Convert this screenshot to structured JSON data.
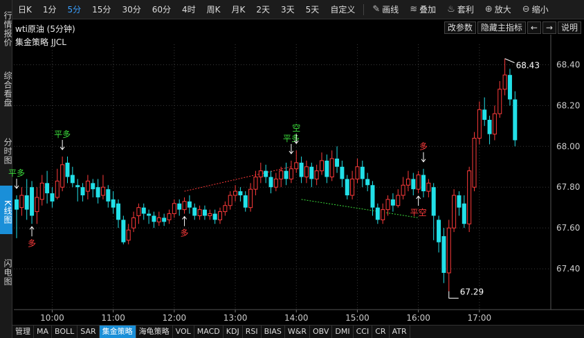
{
  "rail": {
    "tabs": [
      {
        "label": "行情报价",
        "active": false
      },
      {
        "label": "综合看盘",
        "active": false
      },
      {
        "label": "分时图",
        "active": false
      },
      {
        "label": "K线图",
        "active": true
      },
      {
        "label": "闪电图",
        "active": false
      }
    ]
  },
  "toolbar": {
    "periods": [
      {
        "label": "日K",
        "active": false
      },
      {
        "label": "1分",
        "active": false
      },
      {
        "label": "5分",
        "active": true
      },
      {
        "label": "15分",
        "active": false
      },
      {
        "label": "30分",
        "active": false
      },
      {
        "label": "60分",
        "active": false
      },
      {
        "label": "4时",
        "active": false
      },
      {
        "label": "周K",
        "active": false
      },
      {
        "label": "月K",
        "active": false
      },
      {
        "label": "2天",
        "active": false
      },
      {
        "label": "3天",
        "active": false
      },
      {
        "label": "5天",
        "active": false
      },
      {
        "label": "自定义",
        "active": false
      }
    ],
    "tools": [
      {
        "label": "画线",
        "icon": "pencil-icon",
        "glyph": "✎"
      },
      {
        "label": "叠加",
        "icon": "layers-icon",
        "glyph": "≋"
      },
      {
        "label": "套利",
        "icon": "money-bag-icon",
        "glyph": "♨"
      },
      {
        "label": "放大",
        "icon": "zoom-in-icon",
        "glyph": "⊕"
      },
      {
        "label": "缩小",
        "icon": "zoom-out-icon",
        "glyph": "⊖"
      }
    ]
  },
  "header": {
    "title": "wti原油 (5分钟)",
    "change_params": "改参数",
    "hide_indicator": "隐藏主指标",
    "prev_arrow": "←",
    "next_arrow": "→",
    "help": "说明",
    "strategy": "集金策略 JJCL"
  },
  "bottom_tabs": [
    {
      "label": "管理",
      "active": false
    },
    {
      "label": "MA",
      "active": false
    },
    {
      "label": "BOLL",
      "active": false
    },
    {
      "label": "SAR",
      "active": false
    },
    {
      "label": "集金策略",
      "active": true
    },
    {
      "label": "海龟策略",
      "active": false
    },
    {
      "label": "VOL",
      "active": false
    },
    {
      "label": "MACD",
      "active": false
    },
    {
      "label": "KDJ",
      "active": false
    },
    {
      "label": "RSI",
      "active": false
    },
    {
      "label": "BIAS",
      "active": false
    },
    {
      "label": "W&R",
      "active": false
    },
    {
      "label": "OBV",
      "active": false
    },
    {
      "label": "DMI",
      "active": false
    },
    {
      "label": "CCI",
      "active": false
    },
    {
      "label": "CR",
      "active": false
    },
    {
      "label": "ATR",
      "active": false
    }
  ],
  "colors": {
    "up": "#ff3b3b",
    "down": "#22e0e8",
    "grid": "#3a3a3a",
    "signal_long": "#ff3b3b",
    "signal_flat": "#3bdc3b",
    "axis_text": "#cccccc"
  },
  "chart_data": {
    "type": "candlestick",
    "ylim": [
      67.2,
      68.5
    ],
    "y_ticks": [
      67.4,
      67.6,
      67.8,
      68.0,
      68.2,
      68.4
    ],
    "x_tick_labels": [
      {
        "label": "10:00",
        "index": 7
      },
      {
        "label": "11:00",
        "index": 19
      },
      {
        "label": "12:00",
        "index": 31
      },
      {
        "label": "13:00",
        "index": 43
      },
      {
        "label": "14:00",
        "index": 55
      },
      {
        "label": "15:00",
        "index": 67
      },
      {
        "label": "16:00",
        "index": 79
      },
      {
        "label": "17:00",
        "index": 91
      }
    ],
    "candles": [
      [
        67.74,
        67.69,
        67.76,
        67.55
      ],
      [
        67.7,
        67.76,
        67.8,
        67.66
      ],
      [
        67.76,
        67.69,
        67.84,
        67.64
      ],
      [
        67.8,
        67.66,
        67.83,
        67.62
      ],
      [
        67.68,
        67.75,
        67.8,
        67.62
      ],
      [
        67.74,
        67.82,
        67.86,
        67.71
      ],
      [
        67.82,
        67.77,
        67.88,
        67.72
      ],
      [
        67.77,
        67.73,
        67.8,
        67.7
      ],
      [
        67.75,
        67.83,
        67.89,
        67.74
      ],
      [
        67.8,
        67.91,
        67.95,
        67.78
      ],
      [
        67.92,
        67.85,
        67.95,
        67.82
      ],
      [
        67.86,
        67.82,
        67.9,
        67.8
      ],
      [
        67.81,
        67.8,
        67.84,
        67.73
      ],
      [
        67.8,
        67.76,
        67.82,
        67.73
      ],
      [
        67.78,
        67.83,
        67.86,
        67.74
      ],
      [
        67.82,
        67.79,
        67.84,
        67.75
      ],
      [
        67.8,
        67.75,
        67.84,
        67.72
      ],
      [
        67.76,
        67.8,
        67.86,
        67.74
      ],
      [
        67.79,
        67.73,
        67.81,
        67.7
      ],
      [
        67.74,
        67.7,
        67.78,
        67.67
      ],
      [
        67.72,
        67.64,
        67.74,
        67.6
      ],
      [
        67.64,
        67.53,
        67.66,
        67.52
      ],
      [
        67.54,
        67.59,
        67.62,
        67.52
      ],
      [
        67.6,
        67.65,
        67.68,
        67.58
      ],
      [
        67.66,
        67.7,
        67.72,
        67.62
      ],
      [
        67.7,
        67.67,
        67.72,
        67.64
      ],
      [
        67.67,
        67.66,
        67.69,
        67.62
      ],
      [
        67.66,
        67.63,
        67.68,
        67.6
      ],
      [
        67.63,
        67.65,
        67.68,
        67.61
      ],
      [
        67.65,
        67.63,
        67.67,
        67.61
      ],
      [
        67.64,
        67.67,
        67.69,
        67.62
      ],
      [
        67.67,
        67.72,
        67.74,
        67.65
      ],
      [
        67.72,
        67.69,
        67.74,
        67.66
      ],
      [
        67.69,
        67.73,
        67.75,
        67.67
      ],
      [
        67.73,
        67.7,
        67.76,
        67.67
      ],
      [
        67.7,
        67.66,
        67.72,
        67.64
      ],
      [
        67.66,
        67.69,
        67.71,
        67.64
      ],
      [
        67.69,
        67.66,
        67.71,
        67.64
      ],
      [
        67.66,
        67.67,
        67.69,
        67.64
      ],
      [
        67.67,
        67.64,
        67.69,
        67.62
      ],
      [
        67.64,
        67.68,
        67.7,
        67.62
      ],
      [
        67.68,
        67.71,
        67.73,
        67.66
      ],
      [
        67.71,
        67.76,
        67.78,
        67.69
      ],
      [
        67.76,
        67.78,
        67.81,
        67.73
      ],
      [
        67.78,
        67.76,
        67.8,
        67.73
      ],
      [
        67.76,
        67.7,
        67.78,
        67.68
      ],
      [
        67.7,
        67.79,
        67.82,
        67.68
      ],
      [
        67.79,
        67.85,
        67.88,
        67.76
      ],
      [
        67.85,
        67.88,
        67.92,
        67.82
      ],
      [
        67.88,
        67.85,
        67.91,
        67.82
      ],
      [
        67.85,
        67.8,
        67.88,
        67.77
      ],
      [
        67.8,
        67.84,
        67.87,
        67.78
      ],
      [
        67.84,
        67.88,
        67.9,
        67.8
      ],
      [
        67.88,
        67.84,
        67.92,
        67.81
      ],
      [
        67.84,
        67.89,
        67.93,
        67.82
      ],
      [
        67.89,
        67.92,
        67.98,
        67.87
      ],
      [
        67.92,
        67.85,
        67.95,
        67.82
      ],
      [
        67.85,
        67.9,
        67.93,
        67.82
      ],
      [
        67.9,
        67.84,
        67.92,
        67.8
      ],
      [
        67.84,
        67.88,
        67.91,
        67.81
      ],
      [
        67.88,
        67.93,
        67.97,
        67.86
      ],
      [
        67.93,
        67.85,
        67.96,
        67.82
      ],
      [
        67.85,
        67.94,
        67.98,
        67.83
      ],
      [
        67.94,
        67.9,
        68.0,
        67.87
      ],
      [
        67.9,
        67.84,
        67.93,
        67.8
      ],
      [
        67.84,
        67.76,
        67.86,
        67.74
      ],
      [
        67.76,
        67.84,
        67.88,
        67.74
      ],
      [
        67.84,
        67.9,
        67.94,
        67.82
      ],
      [
        67.9,
        67.84,
        67.93,
        67.8
      ],
      [
        67.84,
        67.81,
        67.87,
        67.78
      ],
      [
        67.81,
        67.7,
        67.83,
        67.66
      ],
      [
        67.7,
        67.64,
        67.72,
        67.62
      ],
      [
        67.64,
        67.69,
        67.72,
        67.62
      ],
      [
        67.69,
        67.74,
        67.76,
        67.66
      ],
      [
        67.74,
        67.71,
        67.77,
        67.68
      ],
      [
        67.71,
        67.76,
        67.79,
        67.7
      ],
      [
        67.76,
        67.81,
        67.85,
        67.74
      ],
      [
        67.81,
        67.84,
        67.88,
        67.78
      ],
      [
        67.84,
        67.79,
        67.87,
        67.76
      ],
      [
        67.79,
        67.86,
        67.88,
        67.77
      ],
      [
        67.86,
        67.78,
        67.89,
        67.75
      ],
      [
        67.78,
        67.82,
        67.84,
        67.75
      ],
      [
        67.8,
        67.66,
        67.82,
        67.54
      ],
      [
        67.64,
        67.53,
        67.66,
        67.48
      ],
      [
        67.56,
        67.38,
        67.6,
        67.33
      ],
      [
        67.38,
        67.6,
        67.64,
        67.29
      ],
      [
        67.6,
        67.76,
        67.79,
        67.58
      ],
      [
        67.76,
        67.7,
        67.78,
        67.66
      ],
      [
        67.72,
        67.62,
        67.76,
        67.6
      ],
      [
        67.62,
        67.88,
        67.9,
        67.58
      ],
      [
        67.8,
        68.04,
        68.07,
        67.78
      ],
      [
        68.04,
        68.18,
        68.22,
        68.01
      ],
      [
        68.18,
        68.13,
        68.24,
        68.1
      ],
      [
        68.13,
        68.06,
        68.15,
        68.01
      ],
      [
        68.06,
        68.16,
        68.2,
        68.03
      ],
      [
        68.16,
        68.28,
        68.32,
        68.14
      ],
      [
        68.28,
        68.35,
        68.43,
        68.25
      ],
      [
        68.35,
        68.23,
        68.38,
        68.2
      ],
      [
        68.23,
        68.03,
        68.27,
        68.0
      ]
    ],
    "signals": [
      {
        "index": 0,
        "label": "平多",
        "kind": "flat",
        "position": "above"
      },
      {
        "index": 3,
        "label": "多",
        "kind": "long",
        "position": "below"
      },
      {
        "index": 9,
        "label": "平多",
        "kind": "flat",
        "position": "above"
      },
      {
        "index": 33,
        "label": "多",
        "kind": "long",
        "position": "below"
      },
      {
        "index": 54,
        "label": "平多",
        "kind": "flat",
        "position": "above"
      },
      {
        "index": 55,
        "label": "空",
        "kind": "flat",
        "position": "above"
      },
      {
        "index": 79,
        "label": "平空",
        "kind": "long",
        "position": "below"
      },
      {
        "index": 80,
        "label": "多",
        "kind": "long",
        "position": "above"
      }
    ],
    "annotations": [
      {
        "label": "68.43",
        "index": 96,
        "value": 68.43
      },
      {
        "label": "67.29",
        "index": 85,
        "value": 67.29
      }
    ],
    "trend_lines": [
      {
        "from_index": 33,
        "from_value": 67.78,
        "to_index": 54,
        "to_value": 67.9,
        "kind": "long"
      },
      {
        "from_index": 56,
        "from_value": 67.74,
        "to_index": 79,
        "to_value": 67.65,
        "kind": "flat"
      }
    ]
  }
}
